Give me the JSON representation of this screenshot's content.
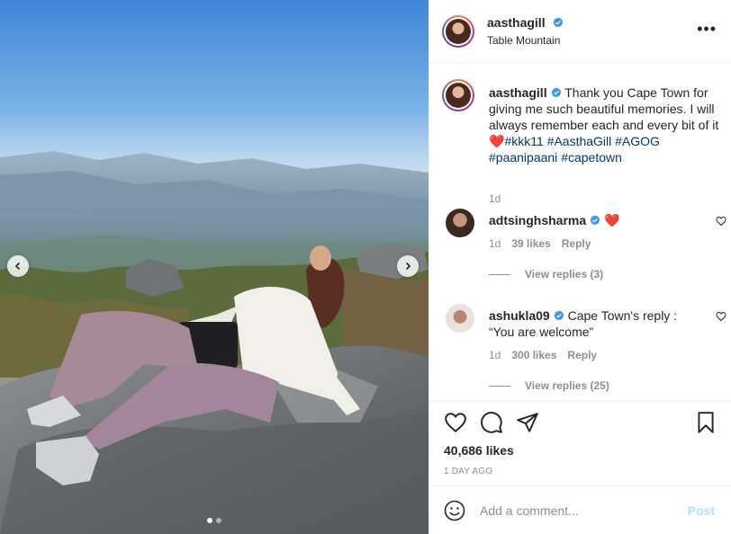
{
  "post": {
    "author": "aasthagill",
    "location": "Table Mountain",
    "caption": {
      "author": "aasthagill",
      "text_plain": " Thank you Cape Town for giving me such beautiful memories. I will always remember each and every bit of it",
      "emoji": "❤️",
      "hashtags": [
        "#kkk11",
        "#AasthaGill",
        "#AGOG",
        "#paanipaani",
        "#capetown"
      ],
      "time": "1d"
    },
    "comments": [
      {
        "author": "adtsinghsharma",
        "text": "❤️",
        "time": "1d",
        "likes": "39 likes",
        "reply_label": "Reply",
        "view_replies": "View replies (3)"
      },
      {
        "author": "ashukla09",
        "text": "Cape Town's reply : “You are welcome”",
        "time": "1d",
        "likes": "300 likes",
        "reply_label": "Reply",
        "view_replies": "View replies (25)"
      }
    ],
    "likes": "40,686 likes",
    "time_ago": "1 DAY AGO",
    "add_comment_placeholder": "Add a comment...",
    "post_button": "Post",
    "more_label": "•••"
  },
  "carousel": {
    "slides": 2,
    "active_index": 0
  },
  "colors": {
    "verified": "#3897f0",
    "link": "#00376b",
    "heart": "#ed4956",
    "muted": "#8e8e8e",
    "post_disabled": "#b2dffc"
  },
  "icons": [
    "chevron-left-icon",
    "chevron-right-icon",
    "verified-icon",
    "more-icon",
    "heart-icon",
    "comment-icon",
    "share-icon",
    "bookmark-icon",
    "emoji-icon"
  ]
}
